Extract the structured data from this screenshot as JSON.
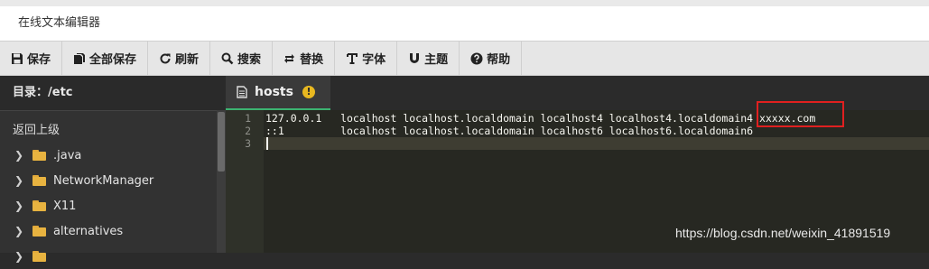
{
  "window": {
    "title": "在线文本编辑器"
  },
  "toolbar": {
    "items": [
      {
        "icon": "save-icon",
        "label": "保存"
      },
      {
        "icon": "save-all-icon",
        "label": "全部保存"
      },
      {
        "icon": "refresh-icon",
        "label": "刷新"
      },
      {
        "icon": "search-icon",
        "label": "搜索"
      },
      {
        "icon": "replace-icon",
        "label": "替换"
      },
      {
        "icon": "font-icon",
        "label": "字体"
      },
      {
        "icon": "theme-icon",
        "label": "主题"
      },
      {
        "icon": "help-icon",
        "label": "帮助"
      }
    ]
  },
  "sidebar": {
    "directory": "目录：/etc",
    "up_label": "返回上级",
    "items": [
      {
        "label": ".java"
      },
      {
        "label": "NetworkManager"
      },
      {
        "label": "X11"
      },
      {
        "label": "alternatives"
      }
    ]
  },
  "tab": {
    "label": "hosts",
    "warn_glyph": "!"
  },
  "editor": {
    "lines": [
      {
        "num": "1",
        "text": "127.0.0.1   localhost localhost.localdomain localhost4 localhost4.localdomain4 xxxxx.com"
      },
      {
        "num": "2",
        "text": "::1         localhost localhost.localdomain localhost6 localhost6.localdomain6"
      },
      {
        "num": "3",
        "text": ""
      }
    ]
  },
  "watermark": "https://blog.csdn.net/weixin_41891519",
  "colors": {
    "accent": "#3cb371",
    "highlight_box": "#e02020",
    "folder": "#e8b340",
    "warning": "#e8b820"
  }
}
